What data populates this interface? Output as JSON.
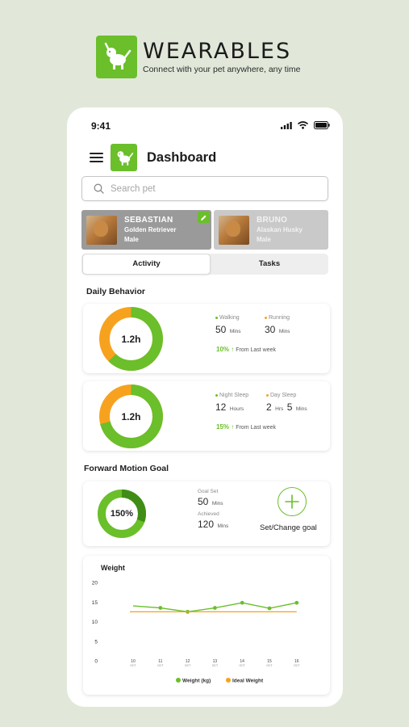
{
  "brand": {
    "name": "WEARABLES",
    "tagline": "Connect with your pet anywhere, any time"
  },
  "status_bar": {
    "time": "9:41"
  },
  "header": {
    "title": "Dashboard"
  },
  "search": {
    "placeholder": "Search pet"
  },
  "pets": [
    {
      "name": "SEBASTIAN",
      "breed": "Golden Retriever",
      "sex": "Male",
      "selected": true
    },
    {
      "name": "BRUNO",
      "breed": "Alaskan Husky",
      "sex": "Male",
      "selected": false
    }
  ],
  "tabs": [
    {
      "label": "Activity",
      "active": true
    },
    {
      "label": "Tasks",
      "active": false
    }
  ],
  "daily_behavior": {
    "title": "Daily Behavior",
    "cards": [
      {
        "center": "1.2h",
        "green_fraction": 0.625,
        "stat1": {
          "label": "Walking",
          "value": "50",
          "unit": "Mins"
        },
        "stat2": {
          "label": "Running",
          "value": "30",
          "unit": "Mins"
        },
        "trend": {
          "value": "10% ↑",
          "text": "From Last week"
        }
      },
      {
        "center": "1.2h",
        "green_fraction": 0.71,
        "stat1": {
          "label": "Night Sleep",
          "value": "12",
          "unit": "Hours"
        },
        "stat2": {
          "label": "Day Sleep",
          "value_a": "2",
          "unit_a": "Hrs",
          "value_b": "5",
          "unit_b": "Mins"
        },
        "trend": {
          "value": "15% ↑",
          "text": "From Last week"
        }
      }
    ]
  },
  "forward_goal": {
    "title": "Forward Motion Goal",
    "percent": "150%",
    "goal_set_label": "Goal Set",
    "goal_set_value": "50",
    "goal_set_unit": "Mins",
    "achieved_label": "Achieved",
    "achieved_value": "120",
    "achieved_unit": "Mins",
    "button_label": "Set/Change goal"
  },
  "colors": {
    "accent_green": "#6abf2a",
    "dark_green": "#3f8d16",
    "orange": "#f7a21e",
    "track": "#d9d9d9"
  },
  "icons": [
    "dog-logo",
    "menu-icon",
    "search-icon",
    "edit-icon",
    "plus-icon",
    "signal-icon",
    "wifi-icon",
    "battery-icon"
  ],
  "chart_data": {
    "type": "line",
    "title": "Weight",
    "categories": [
      "10",
      "11",
      "12",
      "13",
      "14",
      "15",
      "16"
    ],
    "category_sublabel": "OCT",
    "yticks": [
      "20",
      "15",
      "10",
      "5",
      "0"
    ],
    "ylim": [
      0,
      20
    ],
    "series": [
      {
        "name": "Weight (kg)",
        "values": [
          14,
          13.5,
          12.5,
          13.5,
          14.8,
          13.4,
          14.8
        ],
        "color": "#6abf2a"
      },
      {
        "name": "Ideal Weight",
        "values": [
          12.5,
          12.5,
          12.5,
          12.5,
          12.5,
          12.5,
          12.5
        ],
        "color": "#f7a21e"
      }
    ],
    "legend": "bottom"
  }
}
